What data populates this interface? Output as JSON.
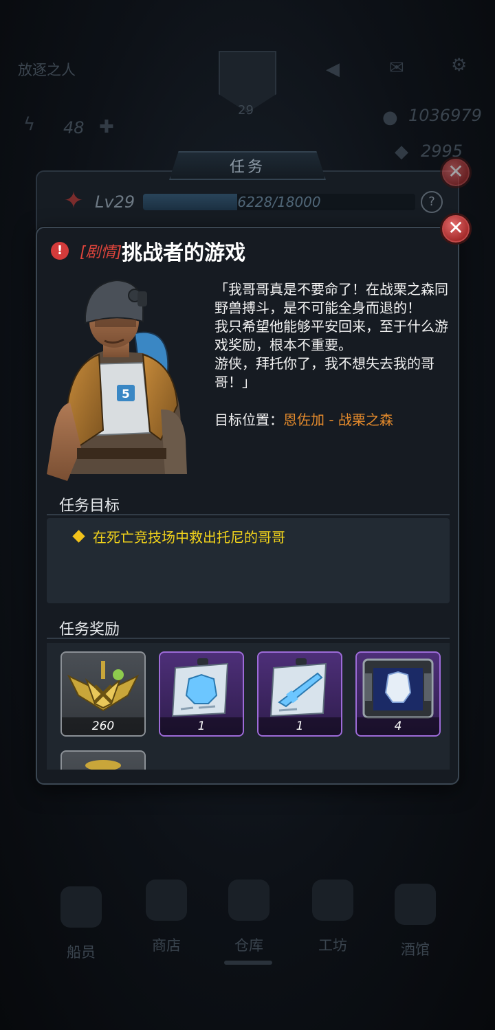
{
  "background": {
    "player_name": "放逐之人",
    "player_level": "29",
    "energy": "48",
    "gold": "1036979",
    "gems": "2995",
    "nav": [
      {
        "label": "船员",
        "icon": "crew-icon"
      },
      {
        "label": "商店",
        "icon": "shop-icon"
      },
      {
        "label": "仓库",
        "icon": "warehouse-icon"
      },
      {
        "label": "工坊",
        "icon": "workshop-icon"
      },
      {
        "label": "酒馆",
        "icon": "tavern-icon"
      }
    ]
  },
  "mission_panel": {
    "tab_label": "任务",
    "level_label": "Lv29",
    "xp_text": "6228/18000",
    "xp_fraction": 0.346,
    "help_label": "?"
  },
  "quest": {
    "tag": "[剧情]",
    "title": "挑战者的游戏",
    "dialogue": "「我哥哥真是不要命了！在战栗之森同野兽搏斗，是不可能全身而退的！\n我只希望他能够平安回来，至于什么游戏奖励，根本不重要。\n游侠，拜托你了，我不想失去我的哥哥！」",
    "target_label": "目标位置：",
    "target_value": "恩佐加 - 战栗之森",
    "objective_heading": "任务目标",
    "objectives": [
      "在死亡竞技场中救出托尼的哥哥"
    ],
    "reward_heading": "任务奖励",
    "rewards": [
      {
        "count": "260",
        "icon": "rank-emblem-icon",
        "rarity": "gray"
      },
      {
        "count": "1",
        "icon": "armor-blueprint-icon",
        "rarity": "purple"
      },
      {
        "count": "1",
        "icon": "weapon-blueprint-icon",
        "rarity": "purple"
      },
      {
        "count": "4",
        "icon": "armor-crate-icon",
        "rarity": "purple"
      }
    ]
  },
  "colors": {
    "accent_orange": "#e58b2c",
    "objective_yellow": "#f2d31b",
    "tag_red": "#e0453c",
    "purple_rarity": "#9d6bd8"
  }
}
